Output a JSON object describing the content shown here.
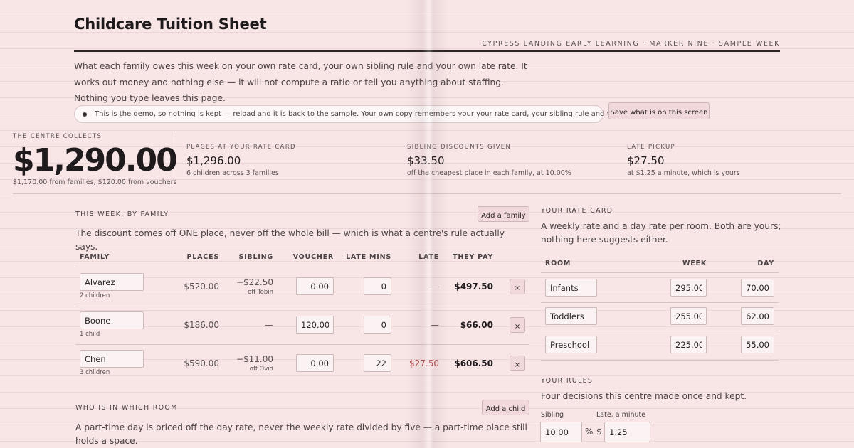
{
  "header": {
    "title": "Childcare Tuition Sheet",
    "subtitle": "CYPRESS LANDING EARLY LEARNING · MARKER NINE · SAMPLE WEEK",
    "intro": "What each family owes this week on your own rate card, your own sibling rule and your own late rate. It works out money and nothing else — it will not compute a ratio or tell you anything about staffing. Nothing you type leaves this page."
  },
  "notice": {
    "text": "This is the demo, so nothing is kept — reload and it is back to the sample. Your own copy remembers your your rate card, your sibling rule and your late rate.",
    "save_label": "Save what is on this screen"
  },
  "summary": {
    "collects_label": "THE CENTRE COLLECTS",
    "collects_value": "$1,290.00",
    "collects_note": "$1,170.00 from families, $120.00 from vouchers",
    "stats": [
      {
        "label": "PLACES AT YOUR RATE CARD",
        "value": "$1,296.00",
        "note": "6 children across 3 families"
      },
      {
        "label": "SIBLING DISCOUNTS GIVEN",
        "value": "$33.50",
        "note": "off the cheapest place in each family, at 10.00%"
      },
      {
        "label": "LATE PICKUP",
        "value": "$27.50",
        "note": "at $1.25 a minute, which is yours"
      }
    ]
  },
  "families": {
    "section_title": "THIS WEEK, BY FAMILY",
    "add_label": "Add a family",
    "description": "The discount comes off ONE place, never off the whole bill — which is what a centre's rule actually says.",
    "columns": [
      "FAMILY",
      "PLACES",
      "SIBLING",
      "VOUCHER",
      "LATE MINS",
      "LATE",
      "THEY PAY"
    ],
    "rows": [
      {
        "name": "Alvarez",
        "children": "2 children",
        "places": "$520.00",
        "sibling": "−$22.50",
        "sibling_note": "off Tobin",
        "voucher": "0.00",
        "late_mins": "0",
        "late": "—",
        "pay": "$497.50",
        "remove": "×"
      },
      {
        "name": "Boone",
        "children": "1 child",
        "places": "$186.00",
        "sibling": "—",
        "sibling_note": "",
        "voucher": "120.00",
        "late_mins": "0",
        "late": "—",
        "pay": "$66.00",
        "remove": "×"
      },
      {
        "name": "Chen",
        "children": "3 children",
        "places": "$590.00",
        "sibling": "−$11.00",
        "sibling_note": "off Ovid",
        "voucher": "0.00",
        "late_mins": "22",
        "late": "$27.50",
        "pay": "$606.50",
        "remove": "×"
      }
    ]
  },
  "rooms": {
    "section_title": "WHO IS IN WHICH ROOM",
    "add_label": "Add a child",
    "description": "A part-time day is priced off the day rate, never the weekly rate divided by five — a part-time place still holds a space."
  },
  "rate_card": {
    "section_title": "YOUR RATE CARD",
    "description": "A weekly rate and a day rate per room. Both are yours; nothing here suggests either.",
    "columns": [
      "ROOM",
      "WEEK",
      "DAY"
    ],
    "rows": [
      {
        "room": "Infants",
        "week": "295.00",
        "day": "70.00"
      },
      {
        "room": "Toddlers",
        "week": "255.00",
        "day": "62.00"
      },
      {
        "room": "Preschool",
        "week": "225.00",
        "day": "55.00"
      }
    ]
  },
  "rules": {
    "section_title": "YOUR RULES",
    "description": "Four decisions this centre made once and kept.",
    "sibling_label": "Sibling",
    "sibling_value": "10.00",
    "percent": "%",
    "late_label": "Late, a minute",
    "currency": "$",
    "late_value": "1.25"
  },
  "colors": {
    "background": "#f8e6e7",
    "late_red": "#b04848",
    "button": "#f1d9db"
  }
}
